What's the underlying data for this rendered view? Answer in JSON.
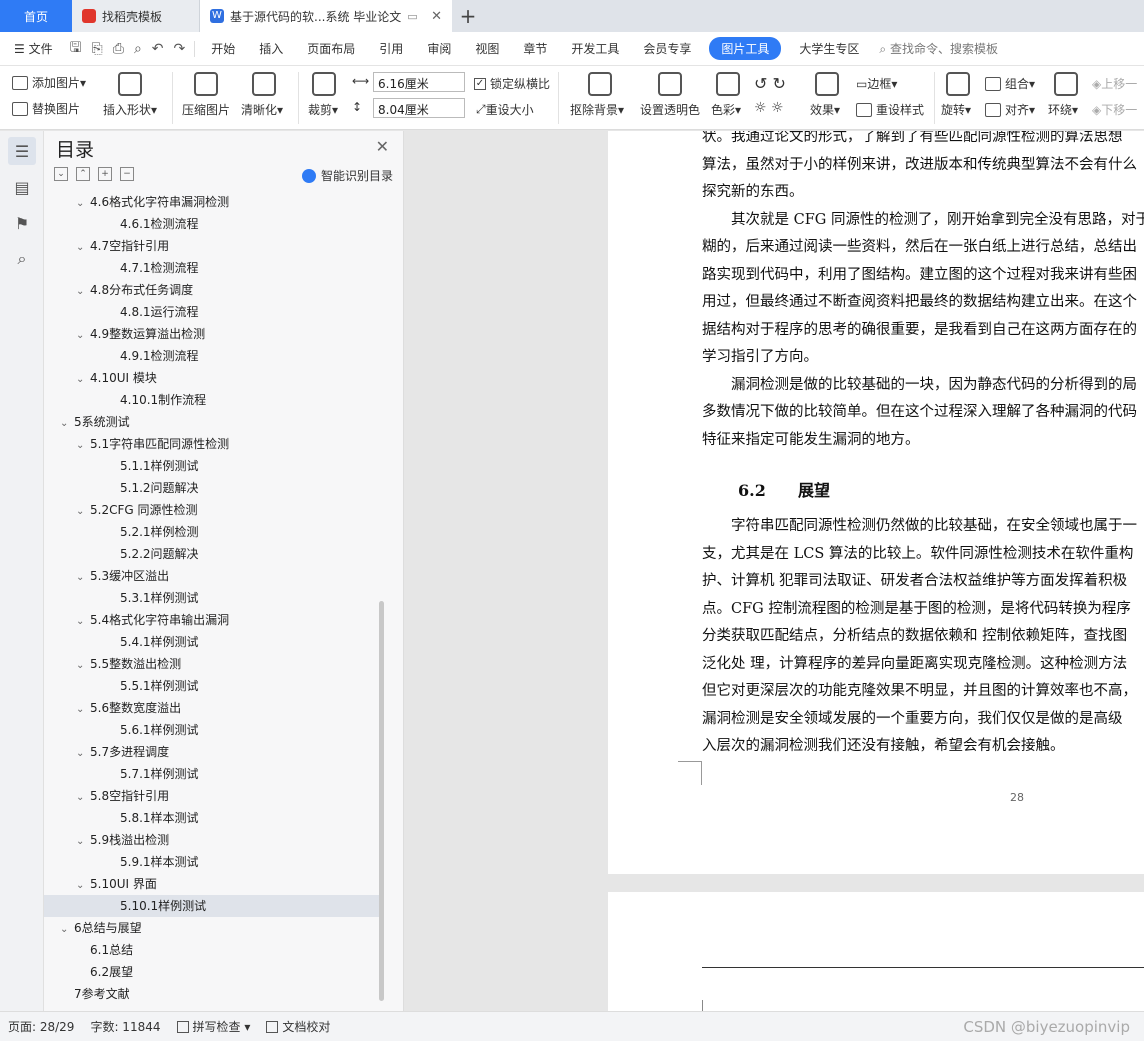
{
  "tabs": {
    "home": "首页",
    "template": "找稻壳模板",
    "document": "基于源代码的软...系统 毕业论文"
  },
  "menu": {
    "file": "文件",
    "items": [
      "开始",
      "插入",
      "页面布局",
      "引用",
      "审阅",
      "视图",
      "章节",
      "开发工具",
      "会员专享"
    ],
    "active": "图片工具",
    "student": "大学生专区",
    "search": "查找命令、搜索模板"
  },
  "ribbon": {
    "add_image": "添加图片",
    "replace_image": "替换图片",
    "insert_shape": "插入形状",
    "compress": "压缩图片",
    "sharpen": "清晰化",
    "crop": "裁剪",
    "width": "6.16厘米",
    "height": "8.04厘米",
    "lock_ratio": "锁定纵横比",
    "reset_size": "重设大小",
    "remove_bg": "抠除背景",
    "set_transparent": "设置透明色",
    "color": "色彩",
    "effect": "效果",
    "border": "边框",
    "reset_style": "重设样式",
    "rotate": "旋转",
    "group": "组合",
    "align": "对齐",
    "wrap": "环绕",
    "bring_forward": "上移一",
    "send_backward": "下移一"
  },
  "toc": {
    "title": "目录",
    "smart": "智能识别目录",
    "items": [
      {
        "text": "4.6格式化字符串漏洞检测",
        "level": 2,
        "arrow": true
      },
      {
        "text": "4.6.1检测流程",
        "level": 3
      },
      {
        "text": "4.7空指针引用",
        "level": 2,
        "arrow": true
      },
      {
        "text": "4.7.1检测流程",
        "level": 3
      },
      {
        "text": "4.8分布式任务调度",
        "level": 2,
        "arrow": true
      },
      {
        "text": "4.8.1运行流程",
        "level": 3
      },
      {
        "text": "4.9整数运算溢出检测",
        "level": 2,
        "arrow": true
      },
      {
        "text": "4.9.1检测流程",
        "level": 3
      },
      {
        "text": "4.10UI 模块",
        "level": 2,
        "arrow": true
      },
      {
        "text": "4.10.1制作流程",
        "level": 3
      },
      {
        "text": "5系统测试",
        "level": 1,
        "arrow": true
      },
      {
        "text": "5.1字符串匹配同源性检测",
        "level": 2,
        "arrow": true
      },
      {
        "text": "5.1.1样例测试",
        "level": 3
      },
      {
        "text": "5.1.2问题解决",
        "level": 3
      },
      {
        "text": "5.2CFG 同源性检测",
        "level": 2,
        "arrow": true
      },
      {
        "text": "5.2.1样例检测",
        "level": 3
      },
      {
        "text": "5.2.2问题解决",
        "level": 3
      },
      {
        "text": "5.3缓冲区溢出",
        "level": 2,
        "arrow": true
      },
      {
        "text": "5.3.1样例测试",
        "level": 3
      },
      {
        "text": "5.4格式化字符串输出漏洞",
        "level": 2,
        "arrow": true
      },
      {
        "text": "5.4.1样例测试",
        "level": 3
      },
      {
        "text": "5.5整数溢出检测",
        "level": 2,
        "arrow": true
      },
      {
        "text": "5.5.1样例测试",
        "level": 3
      },
      {
        "text": "5.6整数宽度溢出",
        "level": 2,
        "arrow": true
      },
      {
        "text": "5.6.1样例测试",
        "level": 3
      },
      {
        "text": "5.7多进程调度",
        "level": 2,
        "arrow": true
      },
      {
        "text": "5.7.1样例测试",
        "level": 3
      },
      {
        "text": "5.8空指针引用",
        "level": 2,
        "arrow": true
      },
      {
        "text": "5.8.1样本测试",
        "level": 3
      },
      {
        "text": "5.9栈溢出检测",
        "level": 2,
        "arrow": true
      },
      {
        "text": "5.9.1样本测试",
        "level": 3
      },
      {
        "text": "5.10UI 界面",
        "level": 2,
        "arrow": true
      },
      {
        "text": "5.10.1样例测试",
        "level": 3,
        "selected": true
      },
      {
        "text": "6总结与展望",
        "level": 1,
        "arrow": true
      },
      {
        "text": "6.1总结",
        "level": 2
      },
      {
        "text": "6.2展望",
        "level": 2
      },
      {
        "text": "7参考文献",
        "level": 1
      }
    ]
  },
  "document": {
    "lines_top": [
      "状。我通过论文的形式，了解到了有些匹配同源性检测的算法思想",
      "算法，虽然对于小的样例来讲，改进版本和传统典型算法不会有什么",
      "探究新的东西。",
      "　　其次就是 CFG 同源性的检测了，刚开始拿到完全没有思路，对于",
      "糊的，后来通过阅读一些资料，然后在一张白纸上进行总结，总结出",
      "路实现到代码中，利用了图结构。建立图的这个过程对我来讲有些困",
      "用过，但最终通过不断查阅资料把最终的数据结构建立出来。在这个",
      "据结构对于程序的思考的确很重要，是我看到自己在这两方面存在的",
      "学习指引了方向。",
      "　　漏洞检测是做的比较基础的一块，因为静态代码的分析得到的局",
      "多数情况下做的比较简单。但在这个过程深入理解了各种漏洞的代码",
      "特征来指定可能发生漏洞的地方。"
    ],
    "heading_num": "6.2",
    "heading_text": "展望",
    "lines_bottom": [
      "　　字符串匹配同源性检测仍然做的比较基础，在安全领域也属于一",
      "支，尤其是在 LCS 算法的比较上。软件同源性检测技术在软件重构",
      "护、计算机 犯罪司法取证、研发者合法权益维护等方面发挥着积极",
      "点。CFG 控制流程图的检测是基于图的检测，是将代码转换为程序",
      "分类获取匹配结点，分析结点的数据依赖和 控制依赖矩阵，查找图",
      "泛化处 理，计算程序的差异向量距离实现克隆检测。这种检测方法",
      "但它对更深层次的功能克隆效果不明显，并且图的计算效率也不高，",
      "漏洞检测是安全领域发展的一个重要方向，我们仅仅是做的是高级",
      "入层次的漏洞检测我们还没有接触，希望会有机会接触。"
    ],
    "page_number": "28"
  },
  "status": {
    "page": "页面: 28/29",
    "words": "字数: 11844",
    "spell": "拼写检查",
    "proof": "文档校对",
    "watermark": "CSDN @biyezuopinvip"
  }
}
